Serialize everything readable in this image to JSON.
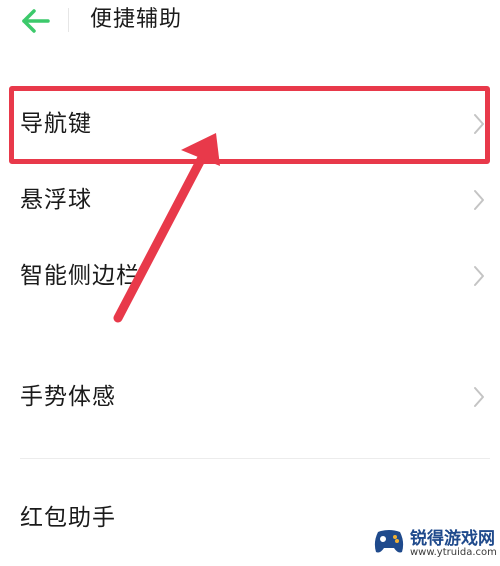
{
  "header": {
    "title": "便捷辅助"
  },
  "menu": {
    "items": [
      {
        "label": "导航键"
      },
      {
        "label": "悬浮球"
      },
      {
        "label": "智能侧边栏"
      },
      {
        "label": "手势体感"
      },
      {
        "label": "红包助手"
      }
    ]
  },
  "watermark": {
    "name": "锐得游戏网",
    "url": "www.ytruida.com"
  },
  "colors": {
    "accent_green": "#3cc96b",
    "highlight_red": "#e8394a",
    "text_primary": "#1a1a1a",
    "chevron_gray": "#c4c4c4"
  }
}
